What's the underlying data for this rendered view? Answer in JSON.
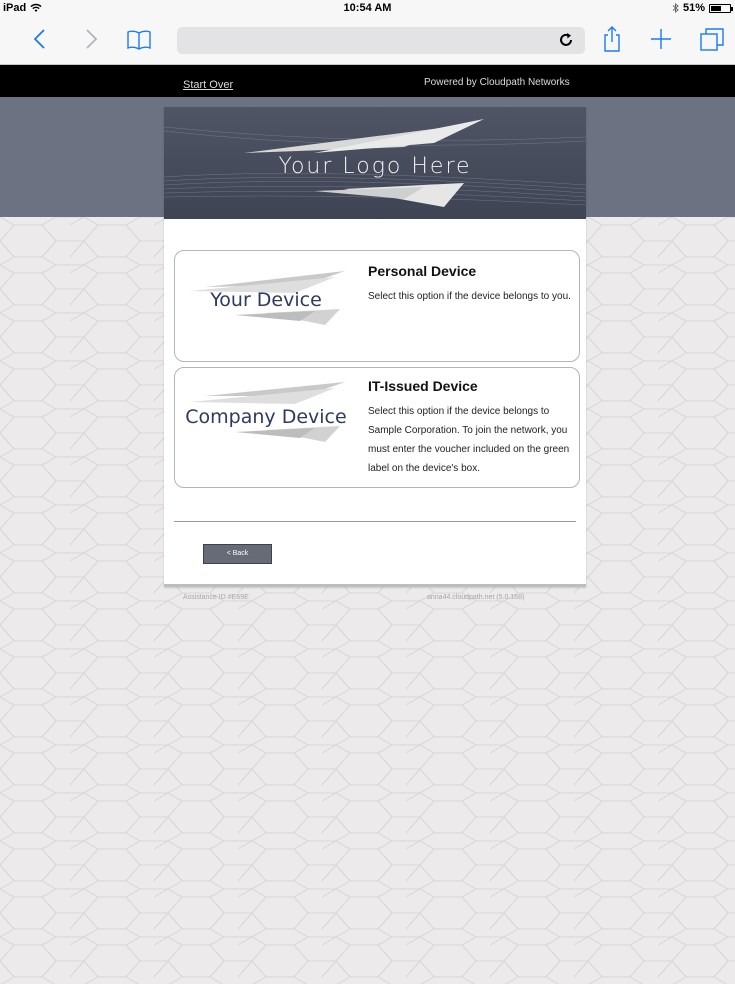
{
  "status_bar": {
    "device": "iPad",
    "time": "10:54 AM",
    "battery": "51%",
    "wifi_icon": "wifi-icon",
    "bluetooth_icon": "bluetooth-icon"
  },
  "browser": {
    "icons": [
      "back-icon",
      "forward-icon",
      "bookmarks-icon",
      "reload-icon",
      "share-icon",
      "new-tab-icon",
      "tabs-icon"
    ]
  },
  "header": {
    "start_over": "Start Over",
    "powered_by": "Powered by Cloudpath Networks"
  },
  "logo": {
    "text": "Your Logo Here"
  },
  "options": [
    {
      "image_label": "Your Device",
      "title": "Personal Device",
      "description": "Select this option if the device belongs to you."
    },
    {
      "image_label": "Company Device",
      "title": "IT-Issued Device",
      "description": "Select this option if the device belongs to Sample Corporation. To join the network, you must enter the voucher included on the green label on the device's box."
    }
  ],
  "back_button": "< Back",
  "footer": {
    "assistance_id": "Assistance ID #E69E",
    "server": "anna44.cloudpath.net (5.0.168)"
  },
  "colors": {
    "band": "#6c7282",
    "top_bar": "#000000",
    "device_label": "#2e3a5f",
    "button": "#676b77"
  }
}
